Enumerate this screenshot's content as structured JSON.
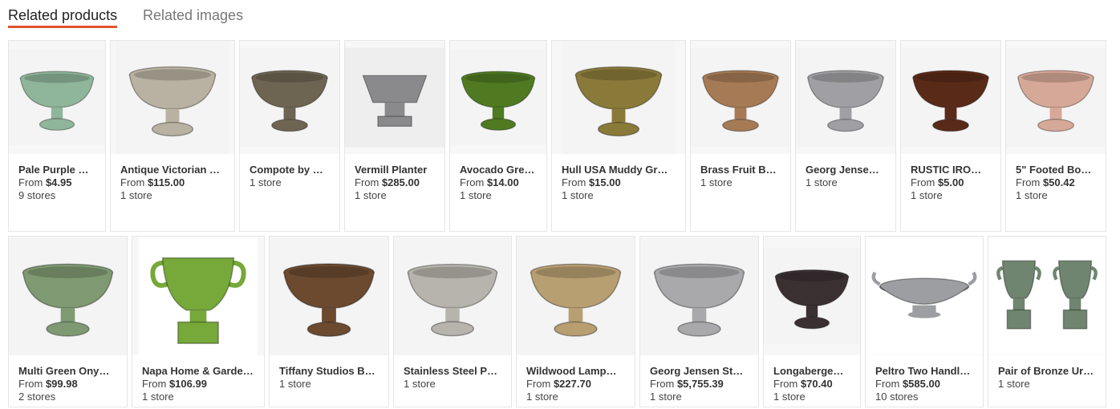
{
  "tabs": [
    {
      "label": "Related products",
      "active": true
    },
    {
      "label": "Related images",
      "active": false
    }
  ],
  "accent_color": "#e0542a",
  "rows": [
    [
      {
        "title": "Pale Purple …",
        "price_prefix": "From ",
        "price": "$4.95",
        "stores": "9 stores",
        "icon": "pedestal-bowl-icon",
        "color": "#8fb59a"
      },
      {
        "title": "Antique Victorian …",
        "price_prefix": "From ",
        "price": "$115.00",
        "stores": "1 store",
        "icon": "pedestal-bowl-icon",
        "color": "#b9b2a2"
      },
      {
        "title": "Compote by …",
        "price_prefix": "",
        "price": "",
        "stores": "1 store",
        "icon": "pedestal-bowl-icon",
        "color": "#6e6452"
      },
      {
        "title": "Vermill Planter",
        "price_prefix": "From ",
        "price": "$285.00",
        "stores": "1 store",
        "icon": "square-planter-icon",
        "color": "#8a8a8c"
      },
      {
        "title": "Avocado Gre…",
        "price_prefix": "From ",
        "price": "$14.00",
        "stores": "1 store",
        "icon": "pedestal-bowl-icon",
        "color": "#4f7a22"
      },
      {
        "title": "Hull USA Muddy Gr…",
        "price_prefix": "From ",
        "price": "$15.00",
        "stores": "1 store",
        "icon": "pedestal-bowl-icon",
        "color": "#8a7a3a"
      },
      {
        "title": "Brass Fruit B…",
        "price_prefix": "",
        "price": "",
        "stores": "1 store",
        "icon": "pedestal-bowl-icon",
        "color": "#a57a55"
      },
      {
        "title": "Georg Jense…",
        "price_prefix": "",
        "price": "",
        "stores": "1 store",
        "icon": "pedestal-bowl-icon",
        "color": "#a0a0a4"
      },
      {
        "title": "RUSTIC IRO…",
        "price_prefix": "From ",
        "price": "$5.00",
        "stores": "1 store",
        "icon": "pedestal-bowl-icon",
        "color": "#5a2a18"
      },
      {
        "title": "5\" Footed Bo…",
        "price_prefix": "From ",
        "price": "$50.42",
        "stores": "1 store",
        "icon": "pedestal-bowl-icon",
        "color": "#d6a898"
      }
    ],
    [
      {
        "title": "Multi Green Ony…",
        "price_prefix": "From ",
        "price": "$99.98",
        "stores": "2 stores",
        "icon": "pedestal-bowl-icon",
        "color": "#7f9a72"
      },
      {
        "title": "Napa Home & Garde…",
        "price_prefix": "From ",
        "price": "$106.99",
        "stores": "1 store",
        "icon": "handled-urn-icon",
        "color": "#76a83a"
      },
      {
        "title": "Tiffany Studios B…",
        "price_prefix": "",
        "price": "",
        "stores": "1 store",
        "icon": "pedestal-bowl-icon",
        "color": "#6b4a30"
      },
      {
        "title": "Stainless Steel P…",
        "price_prefix": "",
        "price": "",
        "stores": "1 store",
        "icon": "pedestal-bowl-icon",
        "color": "#b7b4ad"
      },
      {
        "title": "Wildwood Lamp…",
        "price_prefix": "From ",
        "price": "$227.70",
        "stores": "1 store",
        "icon": "pedestal-bowl-icon",
        "color": "#b79f72"
      },
      {
        "title": "Georg Jensen St…",
        "price_prefix": "From ",
        "price": "$5,755.39",
        "stores": "1 store",
        "icon": "pedestal-bowl-icon",
        "color": "#a9a9ab"
      },
      {
        "title": "Longaberge…",
        "price_prefix": "From ",
        "price": "$70.40",
        "stores": "1 store",
        "icon": "pedestal-bowl-icon",
        "color": "#3a3032"
      },
      {
        "title": "Peltro Two Handl…",
        "price_prefix": "From ",
        "price": "$585.00",
        "stores": "10 stores",
        "icon": "handled-tray-icon",
        "color": "#9c9ea2"
      },
      {
        "title": "Pair of Bronze Ur…",
        "price_prefix": "",
        "price": "",
        "stores": "1 store",
        "icon": "urn-pair-icon",
        "color": "#6f8570"
      }
    ]
  ]
}
